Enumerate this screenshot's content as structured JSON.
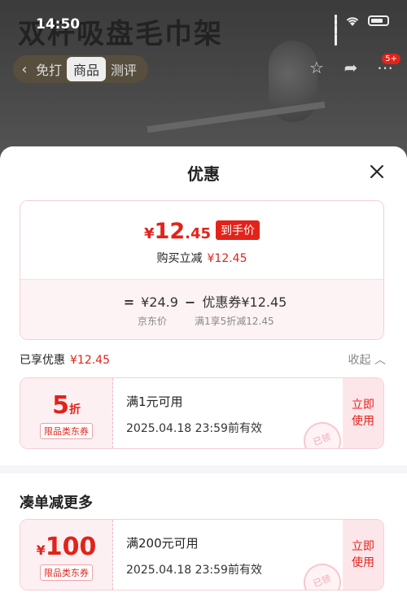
{
  "background": {
    "product_title": "双杆吸盘毛巾架",
    "time": "14:50",
    "nav_tabs": [
      "免打",
      "商品",
      "测评"
    ],
    "cart_badge": "5+"
  },
  "sheet": {
    "title": "优惠",
    "price": {
      "yen": "¥",
      "integer": "12",
      "decimal": ".45",
      "tag": "到手价",
      "sub_label": "购买立减",
      "sub_value": "¥12.45"
    },
    "breakdown": {
      "eq": "=",
      "jd_price": "¥24.9",
      "minus": "−",
      "coupon_label": "优惠券",
      "coupon_value": "¥12.45",
      "jd_price_label": "京东价",
      "coupon_rule": "满1享5折减12.45"
    },
    "enjoyed": {
      "label": "已享优惠",
      "value": "¥12.45",
      "collapse": "收起"
    },
    "coupons": [
      {
        "value_num": "5",
        "value_unit": "折",
        "type": "限品类东券",
        "condition": "满1元可用",
        "expiry": "2025.04.18 23:59前有效",
        "action": "立即使用",
        "stamp": "已领"
      }
    ],
    "more_title": "凑单减更多",
    "more_coupons": [
      {
        "value_yen": "¥",
        "value_num": "100",
        "type": "限品类东券",
        "condition": "满200元可用",
        "expiry": "2025.04.18 23:59前有效",
        "action": "立即使用",
        "stamp": "已领"
      }
    ]
  },
  "colors": {
    "accent": "#e2231a",
    "card_border": "#f6cfd4",
    "coupon_bg": "#fdf0f2"
  }
}
